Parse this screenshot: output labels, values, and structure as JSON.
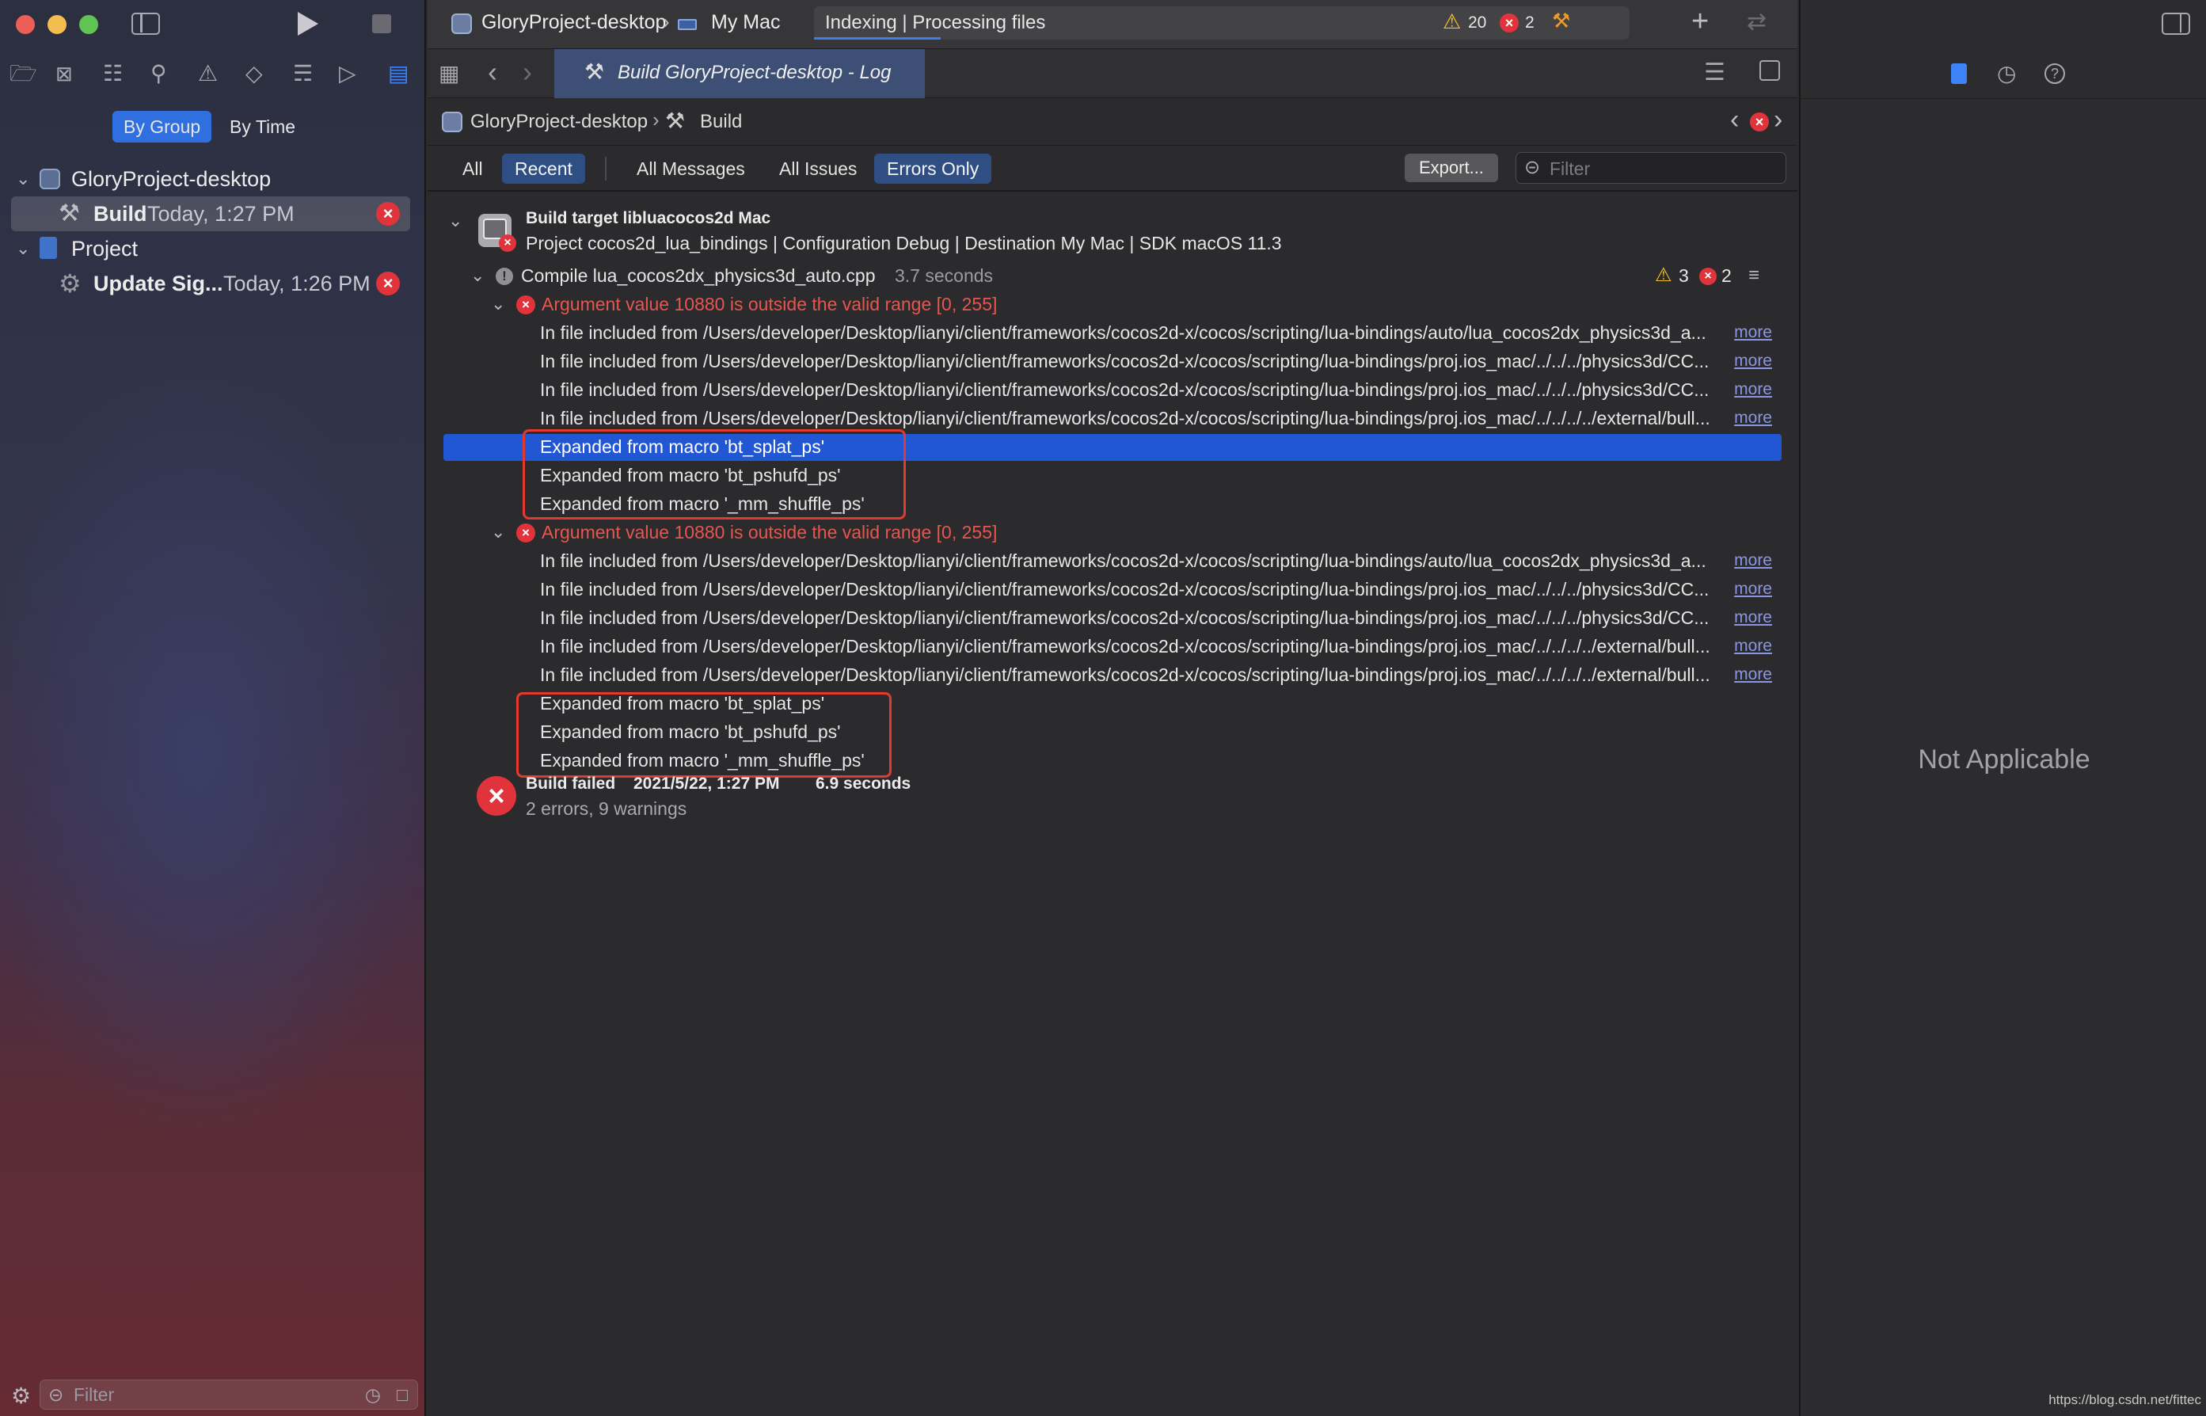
{
  "navigator": {
    "filter_tabs": [
      "By Group",
      "By Time"
    ],
    "tree": [
      {
        "label": "GloryProject-desktop"
      },
      {
        "label": "Build",
        "time": "Today, 1:27 PM"
      },
      {
        "label": "Project"
      },
      {
        "label": "Update Sig...",
        "time": "Today, 1:26 PM"
      }
    ],
    "filter_placeholder": "Filter"
  },
  "titlebar": {
    "scheme": "GloryProject-desktop",
    "destination": "My Mac",
    "status": "Indexing | Processing files",
    "warnings": "20",
    "errors": "2"
  },
  "tab": {
    "title": "Build GloryProject-desktop - Log"
  },
  "jumpbar": {
    "project": "GloryProject-desktop",
    "item": "Build"
  },
  "scopebar": {
    "buttons": [
      "All",
      "Recent",
      "All Messages",
      "All Issues",
      "Errors Only"
    ],
    "export": "Export...",
    "filter_placeholder": "Filter"
  },
  "log": {
    "target_title": "Build target libluacocos2d Mac",
    "target_detail": "Project cocos2d_lua_bindings | Configuration Debug | Destination My Mac | SDK macOS 11.3",
    "compile": "Compile lua_cocos2dx_physics3d_auto.cpp",
    "compile_time": "3.7 seconds",
    "compile_warnings": "3",
    "compile_errors": "2",
    "more": "more",
    "error1": "Argument value 10880 is outside the valid range [0, 255]",
    "error1_files": [
      "In file included from /Users/developer/Desktop/lianyi/client/frameworks/cocos2d-x/cocos/scripting/lua-bindings/auto/lua_cocos2dx_physics3d_a...",
      "In file included from /Users/developer/Desktop/lianyi/client/frameworks/cocos2d-x/cocos/scripting/lua-bindings/proj.ios_mac/../../../physics3d/CC...",
      "In file included from /Users/developer/Desktop/lianyi/client/frameworks/cocos2d-x/cocos/scripting/lua-bindings/proj.ios_mac/../../../physics3d/CC...",
      "In file included from /Users/developer/Desktop/lianyi/client/frameworks/cocos2d-x/cocos/scripting/lua-bindings/proj.ios_mac/../../../../external/bull..."
    ],
    "error1_macros": [
      "Expanded from macro 'bt_splat_ps'",
      "Expanded from macro 'bt_pshufd_ps'",
      "Expanded from macro '_mm_shuffle_ps'"
    ],
    "error2": "Argument value 10880 is outside the valid range [0, 255]",
    "error2_files": [
      "In file included from /Users/developer/Desktop/lianyi/client/frameworks/cocos2d-x/cocos/scripting/lua-bindings/auto/lua_cocos2dx_physics3d_a...",
      "In file included from /Users/developer/Desktop/lianyi/client/frameworks/cocos2d-x/cocos/scripting/lua-bindings/proj.ios_mac/../../../physics3d/CC...",
      "In file included from /Users/developer/Desktop/lianyi/client/frameworks/cocos2d-x/cocos/scripting/lua-bindings/proj.ios_mac/../../../physics3d/CC...",
      "In file included from /Users/developer/Desktop/lianyi/client/frameworks/cocos2d-x/cocos/scripting/lua-bindings/proj.ios_mac/../../../../external/bull...",
      "In file included from /Users/developer/Desktop/lianyi/client/frameworks/cocos2d-x/cocos/scripting/lua-bindings/proj.ios_mac/../../../../external/bull..."
    ],
    "error2_macros": [
      "Expanded from macro 'bt_splat_ps'",
      "Expanded from macro 'bt_pshufd_ps'",
      "Expanded from macro '_mm_shuffle_ps'"
    ],
    "build_failed": "Build failed",
    "build_date": "2021/5/22, 1:27 PM",
    "build_duration": "6.9 seconds",
    "build_summary": "2 errors, 9 warnings"
  },
  "inspector": {
    "empty_text": "Not Applicable"
  },
  "watermark": "https://blog.csdn.net/fittec"
}
